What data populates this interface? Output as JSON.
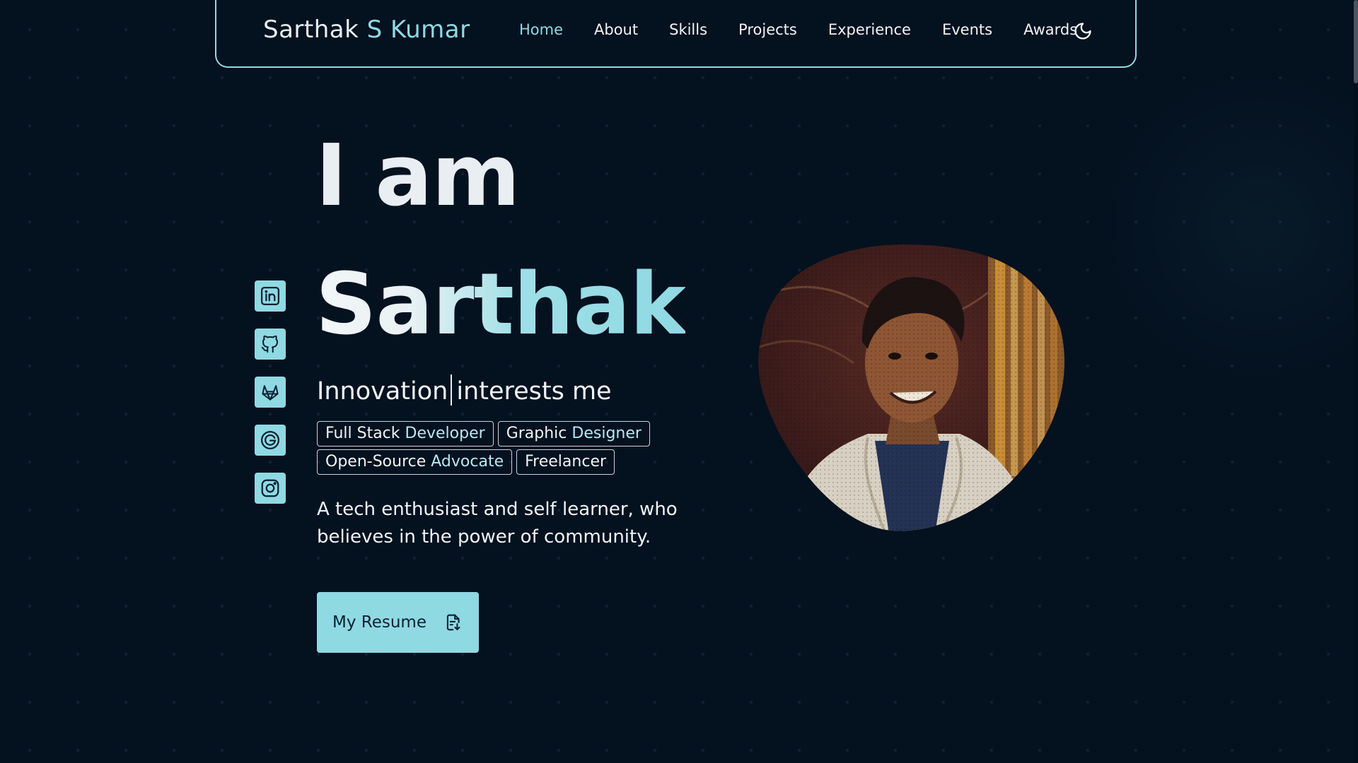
{
  "header": {
    "brand_first": "Sarthak",
    "brand_rest": "S Kumar",
    "nav": [
      {
        "label": "Home",
        "active": true
      },
      {
        "label": "About"
      },
      {
        "label": "Skills"
      },
      {
        "label": "Projects"
      },
      {
        "label": "Experience"
      },
      {
        "label": "Events"
      },
      {
        "label": "Awards"
      }
    ],
    "theme_icon": "moon-icon"
  },
  "socials": [
    {
      "icon": "linkedin-icon"
    },
    {
      "icon": "github-icon"
    },
    {
      "icon": "gitlab-icon"
    },
    {
      "icon": "google-icon"
    },
    {
      "icon": "instagram-icon"
    }
  ],
  "hero": {
    "line1": "I am",
    "name": "Sarthak",
    "tagline_before": "Innovation",
    "tagline_after": "interests me",
    "roles": [
      {
        "w1": "Full Stack",
        "w2": "Developer"
      },
      {
        "w1": "Graphic",
        "w2": "Designer"
      },
      {
        "w1": "Open-Source",
        "w2": "Advocate"
      },
      {
        "w1": "Freelancer",
        "w2": ""
      }
    ],
    "description": "A tech enthusiast and self learner, who believes in the power of community.",
    "resume_label": "My Resume",
    "resume_icon": "document-download-icon"
  },
  "colors": {
    "background": "#04111f",
    "accent": "#8fd9e3",
    "text": "#e8eef2"
  }
}
